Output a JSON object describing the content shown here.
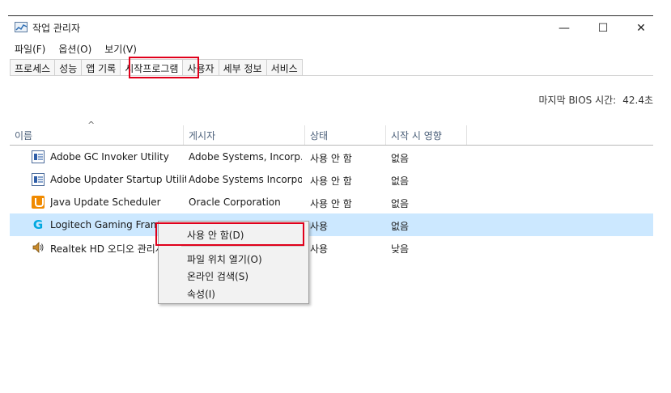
{
  "window": {
    "title": "작업 관리자",
    "app_icon": "task-manager-icon",
    "controls": {
      "minimize": "—",
      "maximize": "☐",
      "close": "✕"
    }
  },
  "menu": {
    "file": "파일(F)",
    "options": "옵션(O)",
    "view": "보기(V)"
  },
  "tabs": [
    {
      "label": "프로세스"
    },
    {
      "label": "성능"
    },
    {
      "label": "앱 기록"
    },
    {
      "label": "시작프로그램"
    },
    {
      "label": "사용자"
    },
    {
      "label": "세부 정보"
    },
    {
      "label": "서비스"
    }
  ],
  "active_tab_index": 3,
  "bios": {
    "label": "마지막 BIOS 시간:",
    "value": "42.4초"
  },
  "columns": {
    "sort_indicator": "^",
    "name": "이름",
    "publisher": "게시자",
    "status": "상태",
    "impact": "시작 시 영향"
  },
  "rows": [
    {
      "icon": "window-app-icon",
      "name": "Adobe GC Invoker Utility",
      "publisher": "Adobe Systems, Incorp...",
      "status": "사용 안 함",
      "impact": "없음"
    },
    {
      "icon": "window-app-icon",
      "name": "Adobe Updater Startup Utility",
      "publisher": "Adobe Systems Incorpo...",
      "status": "사용 안 함",
      "impact": "없음"
    },
    {
      "icon": "java-icon",
      "name": "Java Update Scheduler",
      "publisher": "Oracle Corporation",
      "status": "사용 안 함",
      "impact": "없음"
    },
    {
      "icon": "logitech-icon",
      "name": "Logitech Gaming Framew",
      "publisher": "",
      "status": "사용",
      "impact": "없음",
      "selected": true
    },
    {
      "icon": "speaker-icon",
      "name": "Realtek HD 오디오 관리자",
      "publisher": "",
      "status": "사용",
      "impact": "낮음"
    }
  ],
  "context_menu": {
    "disable": "사용 안 함(D)",
    "open_location": "파일 위치 열기(O)",
    "search_online": "온라인 검색(S)",
    "properties": "속성(I)"
  },
  "colors": {
    "highlight_box": "#e0001b",
    "selected_row": "#cce8ff",
    "header_text": "#4c607a"
  }
}
